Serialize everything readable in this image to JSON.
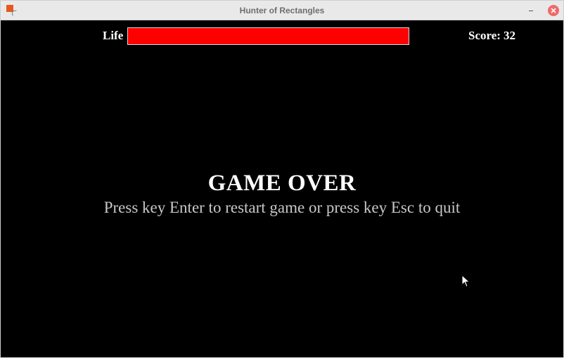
{
  "window": {
    "title": "Hunter of Rectangles",
    "icon": "app-icon",
    "controls": [
      "minimize-icon",
      "close-icon"
    ]
  },
  "hud": {
    "life_label": "Life",
    "life_fraction": 1.0,
    "life_color": "#ff0000",
    "score_label": "Score:",
    "score_value": "32"
  },
  "screen": {
    "game_over_text": "GAME OVER",
    "restart_text": "Press key Enter to restart game or press key Esc to quit"
  },
  "colors": {
    "background": "#000000",
    "text_primary": "#ffffff",
    "text_secondary": "#c8c8c8",
    "close_button": "#f06a6a"
  }
}
